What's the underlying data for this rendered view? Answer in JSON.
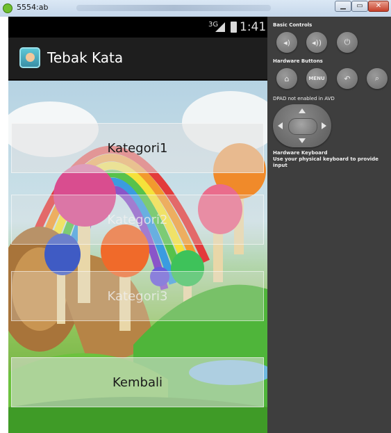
{
  "window": {
    "title": "5554:ab",
    "app_icon": "android-emulator-icon",
    "controls": {
      "minimize": "▁",
      "maximize": "▭",
      "close": "✕"
    }
  },
  "statusbar": {
    "signal_label": "3G",
    "time": "1:41"
  },
  "actionbar": {
    "title": "Tebak Kata",
    "icon": "app-icon"
  },
  "menu": {
    "buttons": [
      {
        "label": "Kategori1"
      },
      {
        "label": "Kategori2"
      },
      {
        "label": "Kategori3"
      },
      {
        "label": "Kembali"
      }
    ]
  },
  "controls_panel": {
    "basic_controls_label": "Basic Controls",
    "hardware_buttons_label": "Hardware Buttons",
    "menu_button_label": "MENU",
    "dpad_note": "DPAD not enabled in AVD",
    "keyboard_note_title": "Hardware Keyboard",
    "keyboard_note_body": "Use your physical keyboard to provide input"
  },
  "colors": {
    "panel_background": "#3e3e3e",
    "actionbar_background": "#1e1e1e",
    "close_button": "#c7402a"
  }
}
